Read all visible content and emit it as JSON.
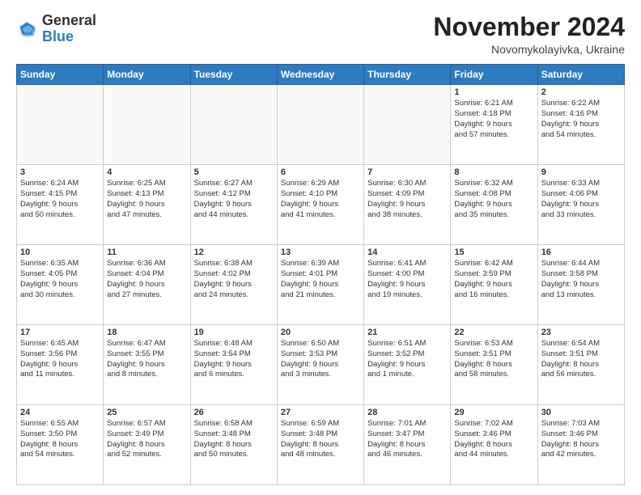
{
  "header": {
    "logo_general": "General",
    "logo_blue": "Blue",
    "month_title": "November 2024",
    "location": "Novomykolayivka, Ukraine"
  },
  "days_of_week": [
    "Sunday",
    "Monday",
    "Tuesday",
    "Wednesday",
    "Thursday",
    "Friday",
    "Saturday"
  ],
  "weeks": [
    [
      {
        "day": "",
        "info": ""
      },
      {
        "day": "",
        "info": ""
      },
      {
        "day": "",
        "info": ""
      },
      {
        "day": "",
        "info": ""
      },
      {
        "day": "",
        "info": ""
      },
      {
        "day": "1",
        "info": "Sunrise: 6:21 AM\nSunset: 4:18 PM\nDaylight: 9 hours\nand 57 minutes."
      },
      {
        "day": "2",
        "info": "Sunrise: 6:22 AM\nSunset: 4:16 PM\nDaylight: 9 hours\nand 54 minutes."
      }
    ],
    [
      {
        "day": "3",
        "info": "Sunrise: 6:24 AM\nSunset: 4:15 PM\nDaylight: 9 hours\nand 50 minutes."
      },
      {
        "day": "4",
        "info": "Sunrise: 6:25 AM\nSunset: 4:13 PM\nDaylight: 9 hours\nand 47 minutes."
      },
      {
        "day": "5",
        "info": "Sunrise: 6:27 AM\nSunset: 4:12 PM\nDaylight: 9 hours\nand 44 minutes."
      },
      {
        "day": "6",
        "info": "Sunrise: 6:29 AM\nSunset: 4:10 PM\nDaylight: 9 hours\nand 41 minutes."
      },
      {
        "day": "7",
        "info": "Sunrise: 6:30 AM\nSunset: 4:09 PM\nDaylight: 9 hours\nand 38 minutes."
      },
      {
        "day": "8",
        "info": "Sunrise: 6:32 AM\nSunset: 4:08 PM\nDaylight: 9 hours\nand 35 minutes."
      },
      {
        "day": "9",
        "info": "Sunrise: 6:33 AM\nSunset: 4:06 PM\nDaylight: 9 hours\nand 33 minutes."
      }
    ],
    [
      {
        "day": "10",
        "info": "Sunrise: 6:35 AM\nSunset: 4:05 PM\nDaylight: 9 hours\nand 30 minutes."
      },
      {
        "day": "11",
        "info": "Sunrise: 6:36 AM\nSunset: 4:04 PM\nDaylight: 9 hours\nand 27 minutes."
      },
      {
        "day": "12",
        "info": "Sunrise: 6:38 AM\nSunset: 4:02 PM\nDaylight: 9 hours\nand 24 minutes."
      },
      {
        "day": "13",
        "info": "Sunrise: 6:39 AM\nSunset: 4:01 PM\nDaylight: 9 hours\nand 21 minutes."
      },
      {
        "day": "14",
        "info": "Sunrise: 6:41 AM\nSunset: 4:00 PM\nDaylight: 9 hours\nand 19 minutes."
      },
      {
        "day": "15",
        "info": "Sunrise: 6:42 AM\nSunset: 3:59 PM\nDaylight: 9 hours\nand 16 minutes."
      },
      {
        "day": "16",
        "info": "Sunrise: 6:44 AM\nSunset: 3:58 PM\nDaylight: 9 hours\nand 13 minutes."
      }
    ],
    [
      {
        "day": "17",
        "info": "Sunrise: 6:45 AM\nSunset: 3:56 PM\nDaylight: 9 hours\nand 11 minutes."
      },
      {
        "day": "18",
        "info": "Sunrise: 6:47 AM\nSunset: 3:55 PM\nDaylight: 9 hours\nand 8 minutes."
      },
      {
        "day": "19",
        "info": "Sunrise: 6:48 AM\nSunset: 3:54 PM\nDaylight: 9 hours\nand 6 minutes."
      },
      {
        "day": "20",
        "info": "Sunrise: 6:50 AM\nSunset: 3:53 PM\nDaylight: 9 hours\nand 3 minutes."
      },
      {
        "day": "21",
        "info": "Sunrise: 6:51 AM\nSunset: 3:52 PM\nDaylight: 9 hours\nand 1 minute."
      },
      {
        "day": "22",
        "info": "Sunrise: 6:53 AM\nSunset: 3:51 PM\nDaylight: 8 hours\nand 58 minutes."
      },
      {
        "day": "23",
        "info": "Sunrise: 6:54 AM\nSunset: 3:51 PM\nDaylight: 8 hours\nand 56 minutes."
      }
    ],
    [
      {
        "day": "24",
        "info": "Sunrise: 6:55 AM\nSunset: 3:50 PM\nDaylight: 8 hours\nand 54 minutes."
      },
      {
        "day": "25",
        "info": "Sunrise: 6:57 AM\nSunset: 3:49 PM\nDaylight: 8 hours\nand 52 minutes."
      },
      {
        "day": "26",
        "info": "Sunrise: 6:58 AM\nSunset: 3:48 PM\nDaylight: 8 hours\nand 50 minutes."
      },
      {
        "day": "27",
        "info": "Sunrise: 6:59 AM\nSunset: 3:48 PM\nDaylight: 8 hours\nand 48 minutes."
      },
      {
        "day": "28",
        "info": "Sunrise: 7:01 AM\nSunset: 3:47 PM\nDaylight: 8 hours\nand 46 minutes."
      },
      {
        "day": "29",
        "info": "Sunrise: 7:02 AM\nSunset: 3:46 PM\nDaylight: 8 hours\nand 44 minutes."
      },
      {
        "day": "30",
        "info": "Sunrise: 7:03 AM\nSunset: 3:46 PM\nDaylight: 8 hours\nand 42 minutes."
      }
    ]
  ]
}
